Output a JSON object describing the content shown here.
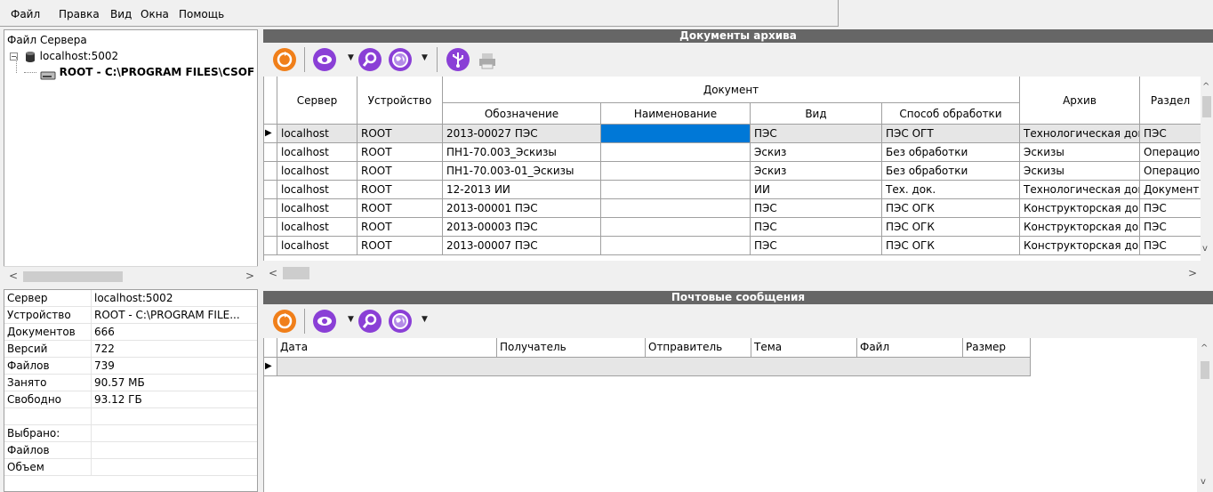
{
  "menu": {
    "file": "Файл",
    "edit": "Правка",
    "view": "Вид",
    "windows": "Окна",
    "help": "Помощь"
  },
  "tree": {
    "root": "Файл Сервера",
    "server": "localhost:5002",
    "device": "ROOT - C:\\PROGRAM FILES\\CSOF"
  },
  "properties": [
    {
      "key": "Сервер",
      "value": "localhost:5002"
    },
    {
      "key": "Устройство",
      "value": "ROOT - C:\\PROGRAM FILE..."
    },
    {
      "key": "Документов",
      "value": "666"
    },
    {
      "key": "Версий",
      "value": "722"
    },
    {
      "key": "Файлов",
      "value": "739"
    },
    {
      "key": "Занято",
      "value": "90.57 МБ"
    },
    {
      "key": "Свободно",
      "value": "93.12 ГБ"
    },
    {
      "key": "",
      "value": ""
    },
    {
      "key": "Выбрано:",
      "value": ""
    },
    {
      "key": "Файлов",
      "value": ""
    },
    {
      "key": "Объем",
      "value": ""
    }
  ],
  "archive": {
    "title": "Документы архива",
    "group_header": "Документ",
    "headers": {
      "server": "Сервер",
      "device": "Устройство",
      "designation": "Обозначение",
      "name": "Наименование",
      "kind": "Вид",
      "method": "Способ обработки",
      "archive": "Архив",
      "section": "Раздел"
    },
    "rows": [
      [
        "localhost",
        "ROOT",
        "2013-00027 ПЭС",
        "",
        "ПЭС",
        "ПЭС ОГТ",
        "Технологическая док",
        "ПЭС"
      ],
      [
        "localhost",
        "ROOT",
        "ПН1-70.003_Эскизы",
        "",
        "Эскиз",
        "Без обработки",
        "Эскизы",
        "Операцио"
      ],
      [
        "localhost",
        "ROOT",
        "ПН1-70.003-01_Эскизы",
        "",
        "Эскиз",
        "Без обработки",
        "Эскизы",
        "Операцио"
      ],
      [
        "localhost",
        "ROOT",
        "12-2013 ИИ",
        "",
        "ИИ",
        "Тех. док.",
        "Технологическая док",
        "Документ"
      ],
      [
        "localhost",
        "ROOT",
        "2013-00001 ПЭС",
        "",
        "ПЭС",
        "ПЭС ОГК",
        "Конструкторская док",
        "ПЭС"
      ],
      [
        "localhost",
        "ROOT",
        "2013-00003 ПЭС",
        "",
        "ПЭС",
        "ПЭС ОГК",
        "Конструкторская док",
        "ПЭС"
      ],
      [
        "localhost",
        "ROOT",
        "2013-00007 ПЭС",
        "",
        "ПЭС",
        "ПЭС ОГК",
        "Конструкторская док",
        "ПЭС"
      ]
    ]
  },
  "mail": {
    "title": "Почтовые сообщения",
    "headers": {
      "date": "Дата",
      "recipient": "Получатель",
      "sender": "Отправитель",
      "subject": "Тема",
      "file": "Файл",
      "size": "Размер"
    }
  },
  "colors": {
    "header_bar": "#666666",
    "selection": "#0078d7",
    "refresh_icon": "#f07f1a",
    "view_icon": "#8a3fd6"
  },
  "icons": [
    "refresh-icon",
    "eye-icon",
    "search-icon",
    "globe-icon",
    "usb-icon",
    "printer-icon"
  ]
}
